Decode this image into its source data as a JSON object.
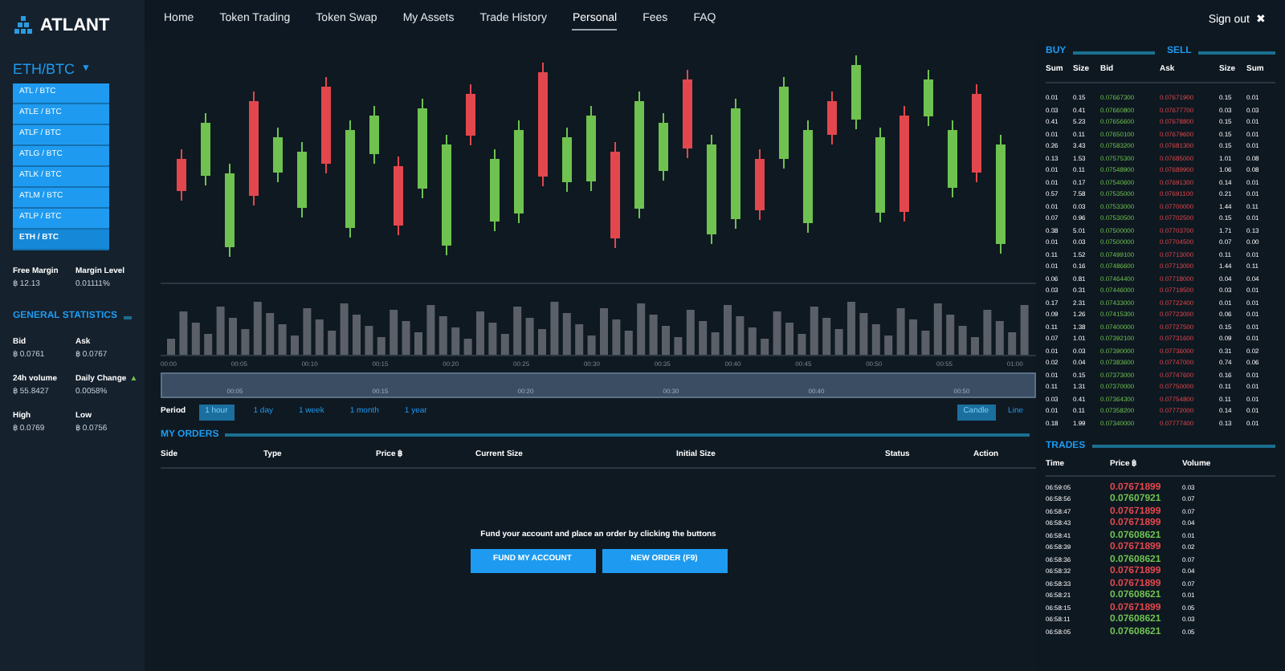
{
  "logo": {
    "text": "ATLANT"
  },
  "nav": {
    "items": [
      {
        "label": "Home",
        "selected": false
      },
      {
        "label": "Token Trading",
        "selected": false
      },
      {
        "label": "Token Swap",
        "selected": false
      },
      {
        "label": "My Assets",
        "selected": false
      },
      {
        "label": "Trade History",
        "selected": false
      },
      {
        "label": "Personal",
        "selected": true
      },
      {
        "label": "Fees",
        "selected": false
      },
      {
        "label": "FAQ",
        "selected": false
      }
    ],
    "sign_out": "Sign out",
    "sign_out_icon": "✖"
  },
  "sidebar": {
    "pair": "ETH/BTC",
    "caret": "▼",
    "pair_menu": [
      {
        "label": "ATL / BTC",
        "selected": false
      },
      {
        "label": "ATLE / BTC",
        "selected": false
      },
      {
        "label": "ATLF / BTC",
        "selected": false
      },
      {
        "label": "ATLG / BTC",
        "selected": false
      },
      {
        "label": "ATLK / BTC",
        "selected": false
      },
      {
        "label": "ATLM / BTC",
        "selected": false
      },
      {
        "label": "ATLP / BTC",
        "selected": false
      },
      {
        "label": "ETH / BTC",
        "selected": true
      }
    ],
    "margin": [
      {
        "label": "Free Margin",
        "value": "฿ 12.13"
      },
      {
        "label": "Margin Level",
        "value": "0.01111%"
      }
    ],
    "stats_title": "GENERAL STATISTICS",
    "stats": [
      {
        "label": "Bid",
        "value": "฿ 0.0761"
      },
      {
        "label": "Ask",
        "value": "฿ 0.0767"
      },
      {
        "label": "24h volume",
        "value": "฿ 55.8427"
      },
      {
        "label": "Daily Change",
        "value": "0.0058%",
        "arrow": "▲"
      },
      {
        "label": "High",
        "value": "฿ 0.0769"
      },
      {
        "label": "Low",
        "value": "฿ 0.0756"
      }
    ]
  },
  "chart": {
    "time_labels": [
      "00:00",
      "00:05",
      "00:10",
      "00:15",
      "00:20",
      "00:25",
      "00:30",
      "00:35",
      "00:40",
      "00:45",
      "00:50",
      "00:55",
      "01:00"
    ],
    "navigator_labels": [
      "00:05",
      "00:15",
      "00:20",
      "00:30",
      "00:40",
      "00:50"
    ],
    "period_label": "Period",
    "periods": [
      {
        "label": "1 hour",
        "selected": true
      },
      {
        "label": "1 day",
        "selected": false
      },
      {
        "label": "1 week",
        "selected": false
      },
      {
        "label": "1 month",
        "selected": false
      },
      {
        "label": "1 year",
        "selected": false
      }
    ],
    "styles": [
      {
        "label": "Candle",
        "selected": true
      },
      {
        "label": "Line",
        "selected": false
      }
    ]
  },
  "my_orders": {
    "title": "MY ORDERS",
    "columns": [
      "Side",
      "Type",
      "Price ฿",
      "Current Size",
      "Initial Size",
      "Status",
      "Action"
    ],
    "message": "Fund your account and place an order by clicking the buttons",
    "buttons": [
      "FUND MY ACCOUNT",
      "NEW ORDER (F9)"
    ]
  },
  "order_book": {
    "buy_title": "BUY",
    "sell_title": "SELL",
    "columns": [
      "Sum",
      "Size",
      "Bid",
      "Ask",
      "Size",
      "Sum"
    ],
    "rows": [
      [
        "0.01",
        "0.15",
        "0.07667300",
        "0.07671900",
        "0.15",
        "0.01"
      ],
      [
        "0.03",
        "0.41",
        "0.07660800",
        "0.07677700",
        "0.03",
        "0.03"
      ],
      [
        "0.41",
        "5.23",
        "0.07656600",
        "0.07678800",
        "0.15",
        "0.01"
      ],
      [
        "0.01",
        "0.11",
        "0.07650100",
        "0.07679600",
        "0.15",
        "0.01"
      ],
      [
        "0.26",
        "3.43",
        "0.07583200",
        "0.07681300",
        "0.15",
        "0.01"
      ],
      [
        "0.13",
        "1.53",
        "0.07575300",
        "0.07685000",
        "1.01",
        "0.08"
      ],
      [
        "0.01",
        "0.11",
        "0.07548900",
        "0.07689900",
        "1.06",
        "0.08"
      ],
      [
        "0.01",
        "0.17",
        "0.07540600",
        "0.07691300",
        "0.14",
        "0.01"
      ],
      [
        "0.57",
        "7.58",
        "0.07535000",
        "0.07691100",
        "0.21",
        "0.01"
      ],
      [
        "0.01",
        "0.03",
        "0.07533000",
        "0.07700000",
        "1.44",
        "0.11"
      ],
      [
        "0.07",
        "0.96",
        "0.07530500",
        "0.07702500",
        "0.15",
        "0.01"
      ],
      [
        "0.38",
        "5.01",
        "0.07500000",
        "0.07703700",
        "1.71",
        "0.13"
      ],
      [
        "0.01",
        "0.03",
        "0.07500000",
        "0.07704500",
        "0.07",
        "0.00"
      ],
      [
        "0.11",
        "1.52",
        "0.07499100",
        "0.07713000",
        "0.11",
        "0.01"
      ],
      [
        "0.01",
        "0.16",
        "0.07486600",
        "0.07713000",
        "1.44",
        "0.11"
      ],
      [
        "0.06",
        "0.81",
        "0.07464400",
        "0.07718000",
        "0.04",
        "0.04"
      ],
      [
        "0.03",
        "0.31",
        "0.07446000",
        "0.07719500",
        "0.03",
        "0.01"
      ],
      [
        "0.17",
        "2.31",
        "0.07433000",
        "0.07722400",
        "0.01",
        "0.01"
      ],
      [
        "0.09",
        "1.26",
        "0.07415300",
        "0.07723000",
        "0.06",
        "0.01"
      ],
      [
        "0.11",
        "1.38",
        "0.07400000",
        "0.07727500",
        "0.15",
        "0.01"
      ],
      [
        "0.07",
        "1.01",
        "0.07392100",
        "0.07731600",
        "0.09",
        "0.01"
      ],
      [
        "0.01",
        "0.03",
        "0.07390000",
        "0.07736000",
        "0.31",
        "0.02"
      ],
      [
        "0.02",
        "0.04",
        "0.07383600",
        "0.07747000",
        "0.74",
        "0.06"
      ],
      [
        "0.01",
        "0.15",
        "0.07373000",
        "0.07747600",
        "0.16",
        "0.01"
      ],
      [
        "0.11",
        "1.31",
        "0.07370000",
        "0.07750000",
        "0.11",
        "0.01"
      ],
      [
        "0.03",
        "0.41",
        "0.07364300",
        "0.07754800",
        "0.11",
        "0.01"
      ],
      [
        "0.01",
        "0.11",
        "0.07358200",
        "0.07772000",
        "0.14",
        "0.01"
      ],
      [
        "0.18",
        "1.99",
        "0.07340000",
        "0.07777400",
        "0.13",
        "0.01"
      ]
    ]
  },
  "trades": {
    "title": "TRADES",
    "columns": [
      "Time",
      "Price ฿",
      "Volume"
    ],
    "rows": [
      {
        "time": "06:59:05",
        "price": "0.07671899",
        "volume": "0.03",
        "color": "#e2474d"
      },
      {
        "time": "06:58:56",
        "price": "0.07607921",
        "volume": "0.07",
        "color": "#6fc24f"
      },
      {
        "time": "06:58:47",
        "price": "0.07671899",
        "volume": "0.07",
        "color": "#e2474d"
      },
      {
        "time": "06:58:43",
        "price": "0.07671899",
        "volume": "0.04",
        "color": "#e2474d"
      },
      {
        "time": "06:58:41",
        "price": "0.07608621",
        "volume": "0.01",
        "color": "#6fc24f"
      },
      {
        "time": "06:58:39",
        "price": "0.07671899",
        "volume": "0.02",
        "color": "#e2474d"
      },
      {
        "time": "06:58:36",
        "price": "0.07608621",
        "volume": "0.07",
        "color": "#6fc24f"
      },
      {
        "time": "06:58:32",
        "price": "0.07671899",
        "volume": "0.04",
        "color": "#e2474d"
      },
      {
        "time": "06:58:33",
        "price": "0.07671899",
        "volume": "0.07",
        "color": "#e2474d"
      },
      {
        "time": "06:58:21",
        "price": "0.07608621",
        "volume": "0.01",
        "color": "#6fc24f"
      },
      {
        "time": "06:58:15",
        "price": "0.07671899",
        "volume": "0.05",
        "color": "#e2474d"
      },
      {
        "time": "06:58:11",
        "price": "0.07608621",
        "volume": "0.03",
        "color": "#6fc24f"
      },
      {
        "time": "06:58:05",
        "price": "0.07608621",
        "volume": "0.05",
        "color": "#6fc24f"
      }
    ]
  }
}
